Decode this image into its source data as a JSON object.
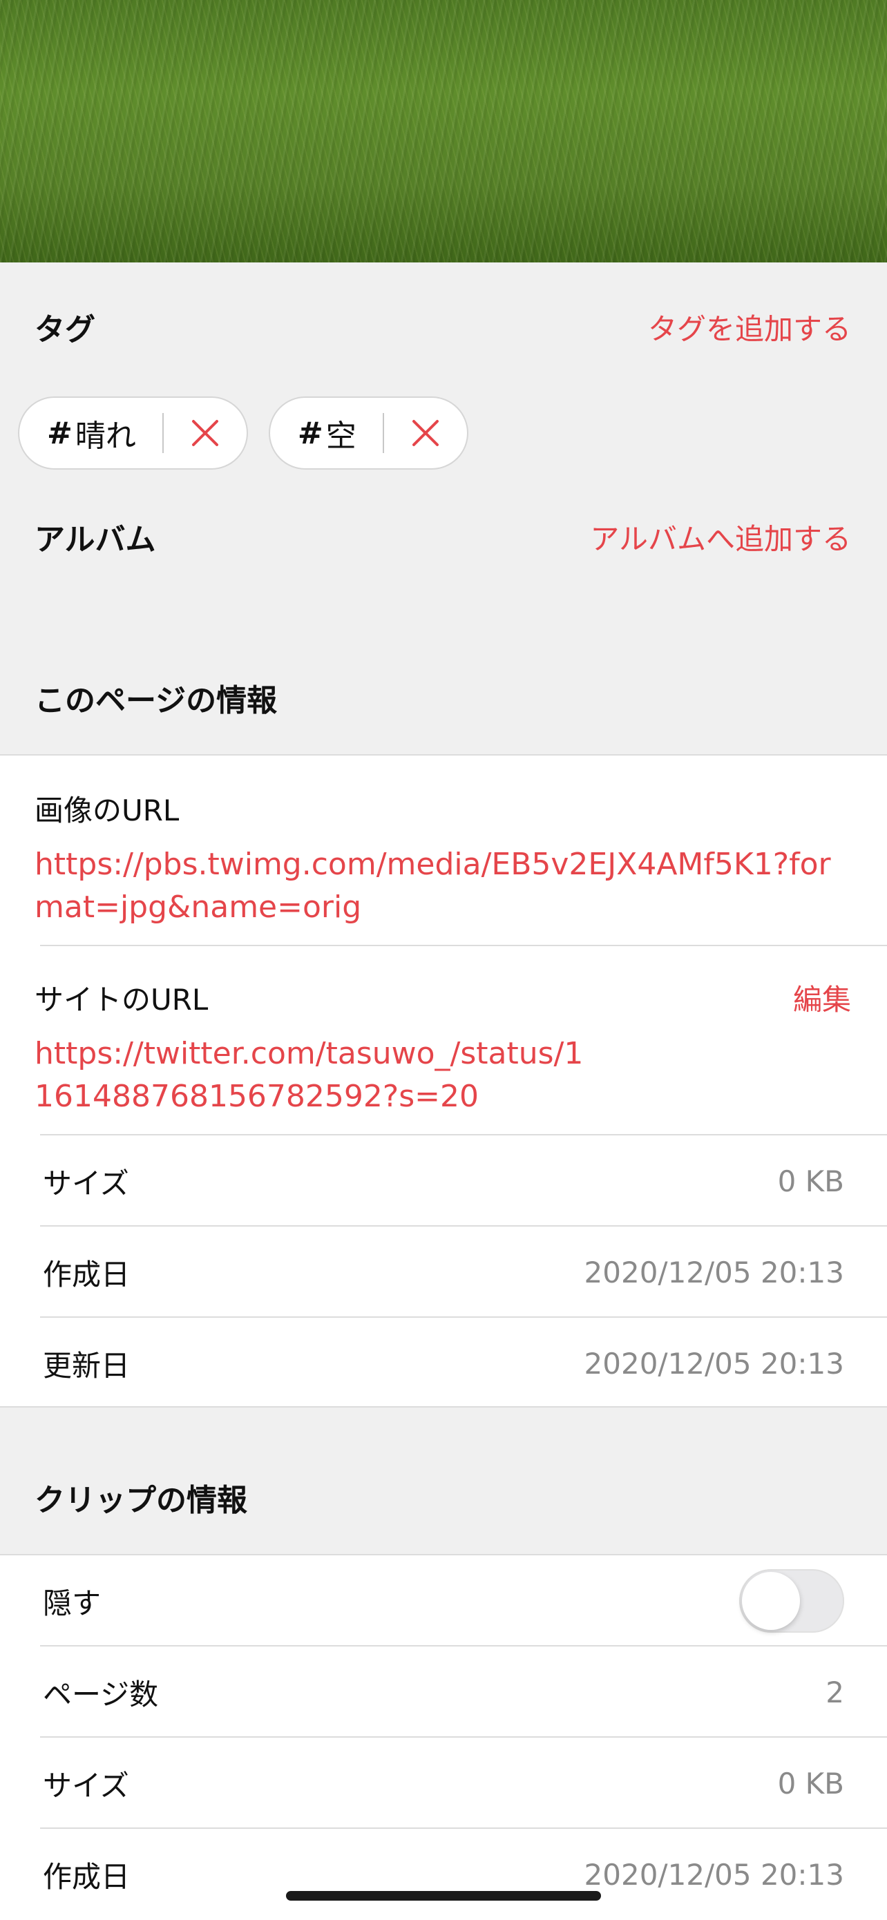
{
  "tags": {
    "heading": "タグ",
    "add_label": "タグを追加する",
    "items": [
      {
        "hash": "#",
        "label": "晴れ"
      },
      {
        "hash": "#",
        "label": "空"
      }
    ]
  },
  "album": {
    "heading": "アルバム",
    "add_label": "アルバムへ追加する"
  },
  "page_info": {
    "heading": "このページの情報",
    "image_url_label": "画像のURL",
    "image_url": "https://pbs.twimg.com/media/EB5v2EJX4AMf5K1?format=jpg&name=orig",
    "site_url_label": "サイトのURL",
    "site_url_edit": "編集",
    "site_url": "https://twitter.com/tasuwo_/status/1161488768156782592?s=20",
    "rows": [
      {
        "label": "サイズ",
        "value": "0 KB"
      },
      {
        "label": "作成日",
        "value": "2020/12/05 20:13"
      },
      {
        "label": "更新日",
        "value": "2020/12/05 20:13"
      }
    ]
  },
  "clip_info": {
    "heading": "クリップの情報",
    "hide_label": "隠す",
    "hide_on": false,
    "rows": [
      {
        "label": "ページ数",
        "value": "2"
      },
      {
        "label": "サイズ",
        "value": "0 KB"
      },
      {
        "label": "作成日",
        "value": "2020/12/05 20:13"
      }
    ]
  },
  "colors": {
    "accent": "#e5454a",
    "background": "#f0f0f0",
    "secondary_text": "#8a8a8a"
  }
}
